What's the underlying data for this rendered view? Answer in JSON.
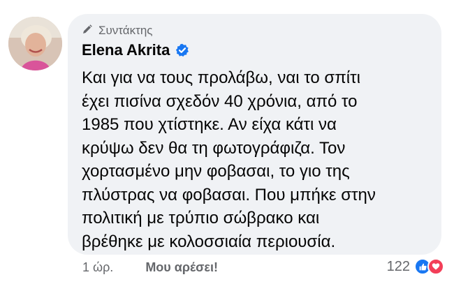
{
  "comment": {
    "role_label": "Συντάκτης",
    "author": "Elena Akrita",
    "text": "Και για να τους προλάβω, ναι το σπίτι\nέχει πισίνα σχεδόν 40 χρόνια, από το\n1985 που χτίστηκε. Αν είχα κάτι να\nκρύψω δεν θα τη φωτογράφιζα. Τον\nχορτασμένο μην φοβασαι, το γιο της\nπλύστρας να φοβασαι. Που μπήκε στην\nπολιτική με τρύπιο σώβρακο και\nβρέθηκε με κολοσσιαία περιουσία.",
    "time": "1 ώρ.",
    "like_action": "Μου αρέσει!",
    "reaction_count": "122",
    "icons": [
      "pencil-icon",
      "verified-badge-icon",
      "like-reaction-icon",
      "love-reaction-icon"
    ]
  },
  "colors": {
    "bubble_bg": "#f0f2f5",
    "meta_gray": "#65676b",
    "verified_blue": "#1877f2",
    "love_red": "#f33e58"
  }
}
